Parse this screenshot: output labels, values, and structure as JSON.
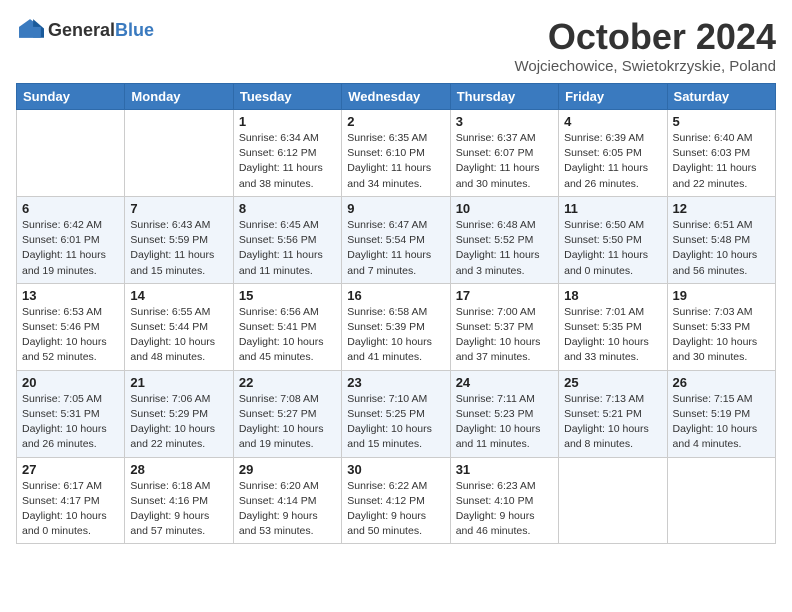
{
  "header": {
    "logo_general": "General",
    "logo_blue": "Blue",
    "month_title": "October 2024",
    "subtitle": "Wojciechowice, Swietokrzyskie, Poland"
  },
  "weekdays": [
    "Sunday",
    "Monday",
    "Tuesday",
    "Wednesday",
    "Thursday",
    "Friday",
    "Saturday"
  ],
  "weeks": [
    [
      {
        "day": "",
        "info": ""
      },
      {
        "day": "",
        "info": ""
      },
      {
        "day": "1",
        "info": "Sunrise: 6:34 AM\nSunset: 6:12 PM\nDaylight: 11 hours and 38 minutes."
      },
      {
        "day": "2",
        "info": "Sunrise: 6:35 AM\nSunset: 6:10 PM\nDaylight: 11 hours and 34 minutes."
      },
      {
        "day": "3",
        "info": "Sunrise: 6:37 AM\nSunset: 6:07 PM\nDaylight: 11 hours and 30 minutes."
      },
      {
        "day": "4",
        "info": "Sunrise: 6:39 AM\nSunset: 6:05 PM\nDaylight: 11 hours and 26 minutes."
      },
      {
        "day": "5",
        "info": "Sunrise: 6:40 AM\nSunset: 6:03 PM\nDaylight: 11 hours and 22 minutes."
      }
    ],
    [
      {
        "day": "6",
        "info": "Sunrise: 6:42 AM\nSunset: 6:01 PM\nDaylight: 11 hours and 19 minutes."
      },
      {
        "day": "7",
        "info": "Sunrise: 6:43 AM\nSunset: 5:59 PM\nDaylight: 11 hours and 15 minutes."
      },
      {
        "day": "8",
        "info": "Sunrise: 6:45 AM\nSunset: 5:56 PM\nDaylight: 11 hours and 11 minutes."
      },
      {
        "day": "9",
        "info": "Sunrise: 6:47 AM\nSunset: 5:54 PM\nDaylight: 11 hours and 7 minutes."
      },
      {
        "day": "10",
        "info": "Sunrise: 6:48 AM\nSunset: 5:52 PM\nDaylight: 11 hours and 3 minutes."
      },
      {
        "day": "11",
        "info": "Sunrise: 6:50 AM\nSunset: 5:50 PM\nDaylight: 11 hours and 0 minutes."
      },
      {
        "day": "12",
        "info": "Sunrise: 6:51 AM\nSunset: 5:48 PM\nDaylight: 10 hours and 56 minutes."
      }
    ],
    [
      {
        "day": "13",
        "info": "Sunrise: 6:53 AM\nSunset: 5:46 PM\nDaylight: 10 hours and 52 minutes."
      },
      {
        "day": "14",
        "info": "Sunrise: 6:55 AM\nSunset: 5:44 PM\nDaylight: 10 hours and 48 minutes."
      },
      {
        "day": "15",
        "info": "Sunrise: 6:56 AM\nSunset: 5:41 PM\nDaylight: 10 hours and 45 minutes."
      },
      {
        "day": "16",
        "info": "Sunrise: 6:58 AM\nSunset: 5:39 PM\nDaylight: 10 hours and 41 minutes."
      },
      {
        "day": "17",
        "info": "Sunrise: 7:00 AM\nSunset: 5:37 PM\nDaylight: 10 hours and 37 minutes."
      },
      {
        "day": "18",
        "info": "Sunrise: 7:01 AM\nSunset: 5:35 PM\nDaylight: 10 hours and 33 minutes."
      },
      {
        "day": "19",
        "info": "Sunrise: 7:03 AM\nSunset: 5:33 PM\nDaylight: 10 hours and 30 minutes."
      }
    ],
    [
      {
        "day": "20",
        "info": "Sunrise: 7:05 AM\nSunset: 5:31 PM\nDaylight: 10 hours and 26 minutes."
      },
      {
        "day": "21",
        "info": "Sunrise: 7:06 AM\nSunset: 5:29 PM\nDaylight: 10 hours and 22 minutes."
      },
      {
        "day": "22",
        "info": "Sunrise: 7:08 AM\nSunset: 5:27 PM\nDaylight: 10 hours and 19 minutes."
      },
      {
        "day": "23",
        "info": "Sunrise: 7:10 AM\nSunset: 5:25 PM\nDaylight: 10 hours and 15 minutes."
      },
      {
        "day": "24",
        "info": "Sunrise: 7:11 AM\nSunset: 5:23 PM\nDaylight: 10 hours and 11 minutes."
      },
      {
        "day": "25",
        "info": "Sunrise: 7:13 AM\nSunset: 5:21 PM\nDaylight: 10 hours and 8 minutes."
      },
      {
        "day": "26",
        "info": "Sunrise: 7:15 AM\nSunset: 5:19 PM\nDaylight: 10 hours and 4 minutes."
      }
    ],
    [
      {
        "day": "27",
        "info": "Sunrise: 6:17 AM\nSunset: 4:17 PM\nDaylight: 10 hours and 0 minutes."
      },
      {
        "day": "28",
        "info": "Sunrise: 6:18 AM\nSunset: 4:16 PM\nDaylight: 9 hours and 57 minutes."
      },
      {
        "day": "29",
        "info": "Sunrise: 6:20 AM\nSunset: 4:14 PM\nDaylight: 9 hours and 53 minutes."
      },
      {
        "day": "30",
        "info": "Sunrise: 6:22 AM\nSunset: 4:12 PM\nDaylight: 9 hours and 50 minutes."
      },
      {
        "day": "31",
        "info": "Sunrise: 6:23 AM\nSunset: 4:10 PM\nDaylight: 9 hours and 46 minutes."
      },
      {
        "day": "",
        "info": ""
      },
      {
        "day": "",
        "info": ""
      }
    ]
  ]
}
